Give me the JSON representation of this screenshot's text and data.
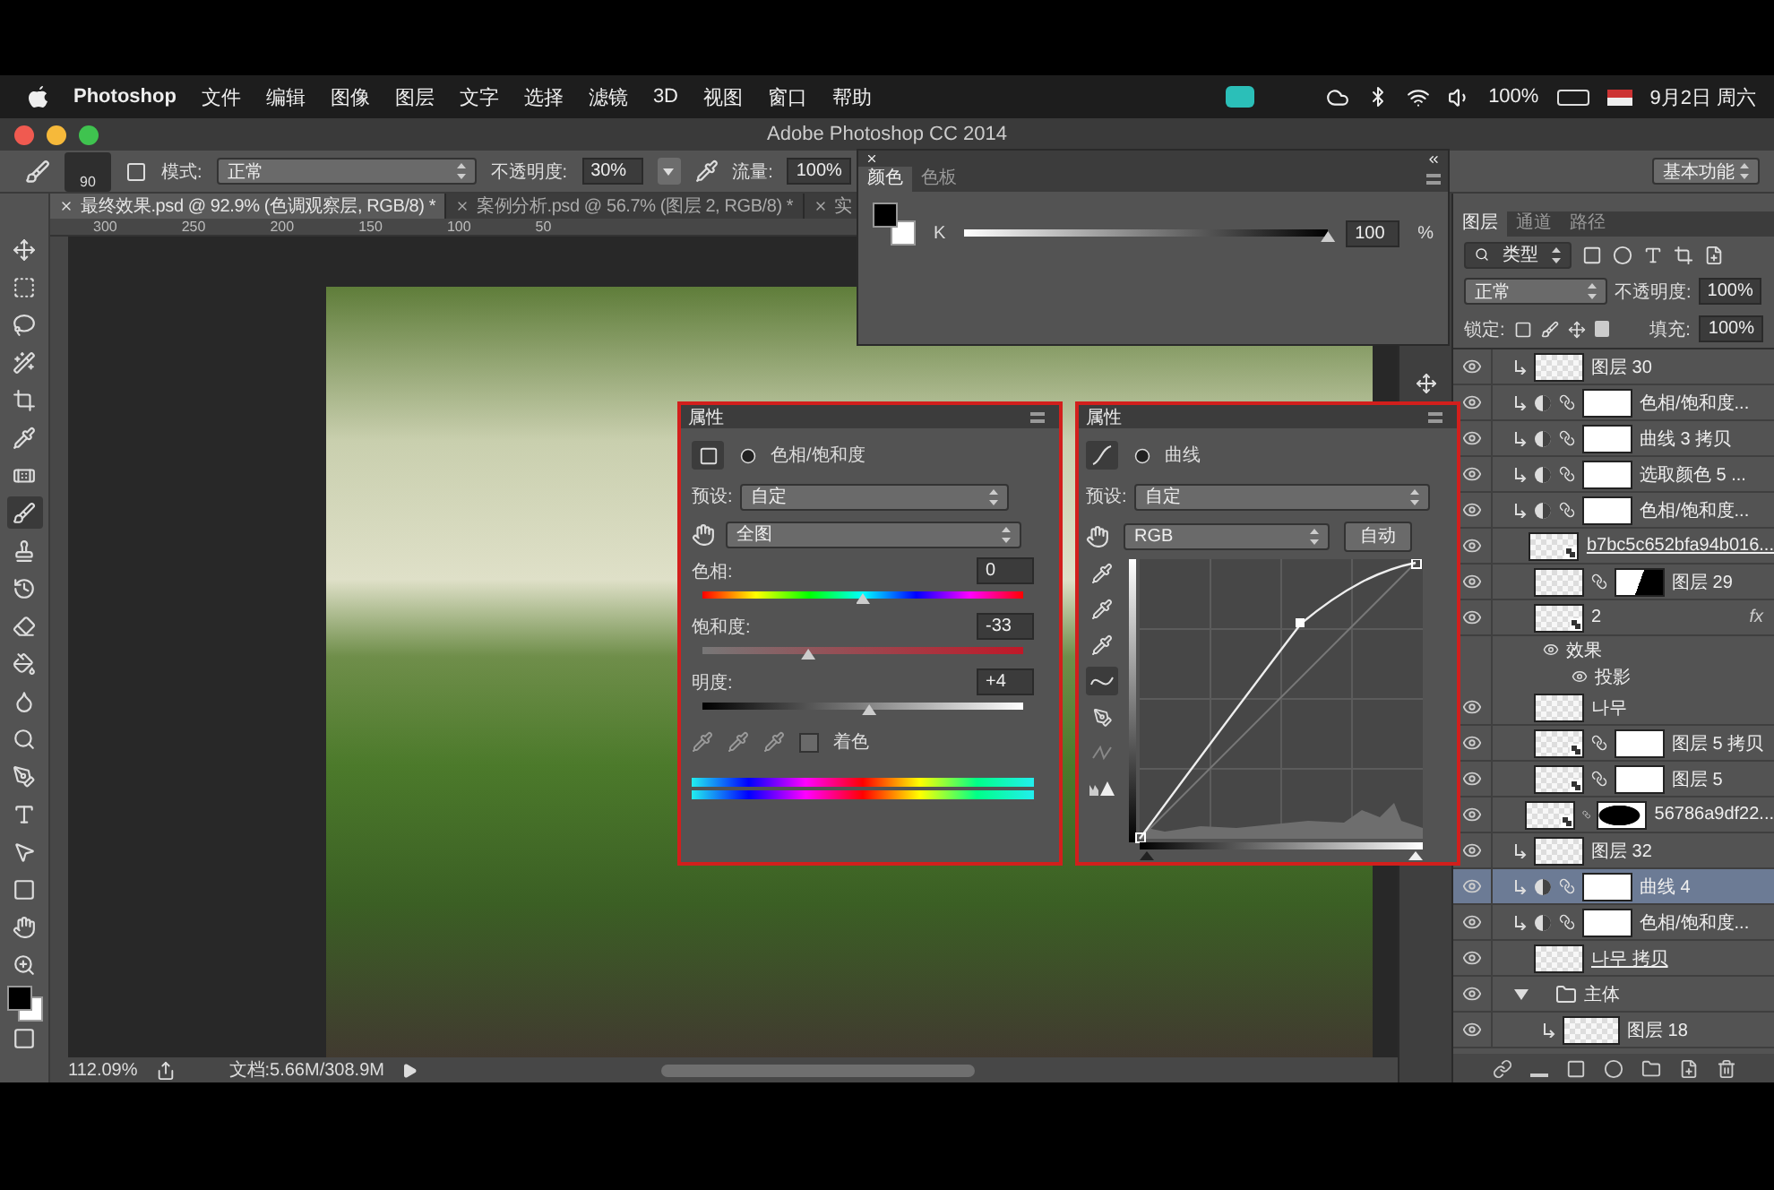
{
  "menubar": {
    "app": "Photoshop",
    "menus": [
      "文件",
      "编辑",
      "图像",
      "图层",
      "文字",
      "选择",
      "滤镜",
      "3D",
      "视图",
      "窗口",
      "帮助"
    ],
    "battery": "100%",
    "clock": "9月2日 周六"
  },
  "window": {
    "title": "Adobe Photoshop CC 2014"
  },
  "options_bar": {
    "brush_size": "90",
    "mode_label": "模式:",
    "mode": "正常",
    "opacity_label": "不透明度:",
    "opacity": "30%",
    "flow_label": "流量:",
    "flow": "100%",
    "workspace": "基本功能"
  },
  "doc_tabs": [
    {
      "label": "最终效果.psd @ 92.9% (色调观察层, RGB/8) *",
      "selected": true
    },
    {
      "label": "案例分析.psd @ 56.7% (图层 2, RGB/8) *",
      "selected": false
    },
    {
      "label": "实",
      "selected": false
    }
  ],
  "ruler": [
    "300",
    "250",
    "200",
    "150",
    "100",
    "50"
  ],
  "status_bar": {
    "zoom": "112.09%",
    "document": "文档:5.66M/308.9M"
  },
  "color_panel": {
    "tabs": [
      {
        "label": "颜色",
        "selected": true
      },
      {
        "label": "色板",
        "selected": false
      }
    ],
    "channel": "K",
    "level": 1,
    "value": "100",
    "unit": "%"
  },
  "hue_panel": {
    "title": "属性",
    "adjustment": "色相/饱和度",
    "preset_label": "预设:",
    "preset": "自定",
    "range": "全图",
    "sliders": [
      {
        "kind": "hue",
        "label": "色相:",
        "value": "0",
        "level": 0.5
      },
      {
        "kind": "saturation",
        "label": "饱和度:",
        "value": "-33",
        "level": 0.33
      },
      {
        "kind": "lightness",
        "label": "明度:",
        "value": "+4",
        "level": 0.52
      }
    ],
    "colorize": {
      "label": "着色",
      "checked": false
    }
  },
  "curves_panel": {
    "title": "属性",
    "adjustment": "曲线",
    "preset_label": "预设:",
    "preset": "自定",
    "channel": "RGB",
    "auto_button": "自动",
    "input_sliders": [
      {
        "level": 0
      },
      {
        "level": 1
      }
    ]
  },
  "layers_panel": {
    "tabs": [
      {
        "label": "图层",
        "selected": true
      },
      {
        "label": "通道",
        "selected": false
      },
      {
        "label": "路径",
        "selected": false
      }
    ],
    "filter": "类型",
    "blend_mode": "正常",
    "opacity_label": "不透明度:",
    "opacity": "100%",
    "lock_label": "锁定:",
    "fill_label": "填充:",
    "fill": "100%",
    "layers": [
      {
        "name": "图层 30",
        "kind": "pixel",
        "clipped": true,
        "selected": false
      },
      {
        "name": "色相/饱和度...",
        "kind": "adjustment",
        "clipped": true,
        "selected": false
      },
      {
        "name": "曲线 3 拷贝",
        "kind": "adjustment",
        "clipped": true,
        "selected": false
      },
      {
        "name": "选取颜色 5 ...",
        "kind": "adjustment",
        "clipped": true,
        "selected": false
      },
      {
        "name": "色相/饱和度...",
        "kind": "adjustment",
        "clipped": true,
        "selected": false
      },
      {
        "name": "b7bc5c652bfa94b016...",
        "kind": "smart",
        "clipped": false,
        "selected": false,
        "linked": true
      },
      {
        "name": "图层 29",
        "kind": "pixel",
        "clipped": false,
        "selected": false,
        "mask": {
          "kind": "split"
        }
      },
      {
        "name": "2",
        "kind": "smart",
        "clipped": false,
        "selected": false,
        "effects_badge": "fx",
        "children": [
          {
            "name": "效果",
            "children": [
              {
                "name": "投影"
              }
            ]
          }
        ]
      },
      {
        "name": "나무",
        "kind": "pixel",
        "clipped": false,
        "selected": false
      },
      {
        "name": "图层 5 拷贝",
        "kind": "smart",
        "clipped": false,
        "selected": false,
        "mask": {
          "kind": "white"
        }
      },
      {
        "name": "图层 5",
        "kind": "smart",
        "clipped": false,
        "selected": false,
        "mask": {
          "kind": "white"
        }
      },
      {
        "name": "56786a9df22...",
        "kind": "smart",
        "clipped": false,
        "selected": false,
        "mask": {
          "kind": "blob"
        }
      },
      {
        "name": "图层 32",
        "kind": "pixel",
        "clipped": true,
        "selected": false
      },
      {
        "name": "曲线 4",
        "kind": "adjustment",
        "clipped": true,
        "selected": true
      },
      {
        "name": "色相/饱和度...",
        "kind": "adjustment",
        "clipped": true,
        "selected": false
      },
      {
        "name": "나무 拷贝",
        "kind": "pixel",
        "clipped": false,
        "selected": false,
        "linked": true
      },
      {
        "name": "主体",
        "kind": "group",
        "clipped": false,
        "selected": false,
        "expanded": true,
        "children": [
          {
            "name": "图层 18",
            "kind": "pixel",
            "clipped": true,
            "selected": false
          }
        ]
      }
    ]
  }
}
